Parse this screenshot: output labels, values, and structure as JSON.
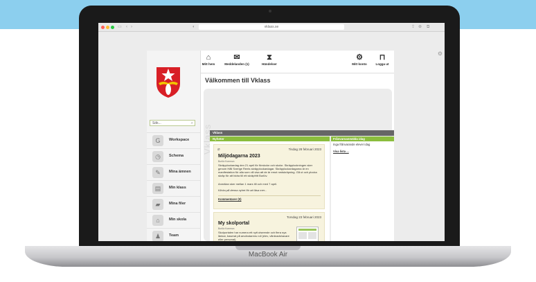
{
  "device": {
    "brand": "MacBook Air"
  },
  "browser": {
    "address": "vklass.se"
  },
  "sidebar": {
    "search_placeholder": "Sök...",
    "items": [
      {
        "label": "Workspace",
        "icon": "workspace-icon"
      },
      {
        "label": "Schema",
        "icon": "clock-icon"
      },
      {
        "label": "Mina ämnen",
        "icon": "books-icon"
      },
      {
        "label": "Min klass",
        "icon": "class-icon"
      },
      {
        "label": "Mina filer",
        "icon": "folder-icon"
      },
      {
        "label": "Min skola",
        "icon": "school-icon"
      },
      {
        "label": "Team",
        "icon": "team-icon"
      }
    ]
  },
  "topnav": {
    "home": "Mitt hem",
    "messages": "Meddelanden (1)",
    "events": "Händelser",
    "account": "Mitt konto",
    "logout": "Logga ut"
  },
  "main": {
    "welcome": "Välkommen till Vklass",
    "side_watermark": "Vklass",
    "section_title": "Vklass",
    "news_header": "Nyheter",
    "absence_header": "Frånvaroanmälda idag",
    "absence_text": "Inga frånvarande elever idag",
    "absence_link": "Visa lista ..."
  },
  "news": [
    {
      "date": "Tisdag 28 februari 2023",
      "title": "Miljödagarna 2023",
      "author": "Burlöv Kommun",
      "body": "Skräpplockardag den 21 april för förskolor och skolor. Skräpplockningen sker genom Håll Sverige Rents skräpplockardagar. Skräpplockardagarna är en manifestation för alla som vill visa att de är emot nedskräpning. Gå ut och plocka skräp för att bidra till ett skräpfritt Burlöv.",
      "body2": "Anmälan sker mellan 1 mars till och med 7 april.",
      "more": "Klicka på denna nyhet för att läsa mer...",
      "comments": "Kommentarer (0)"
    },
    {
      "date": "Torsdag 23 februari 2023",
      "title": "My skolportal",
      "author": "Burlöv Kommun",
      "body": "Skolportalen har numera ett nytt utseende och flera nya länkar, baserat på användarens roll (elev, vårdnadshavare eller personal)."
    }
  ]
}
